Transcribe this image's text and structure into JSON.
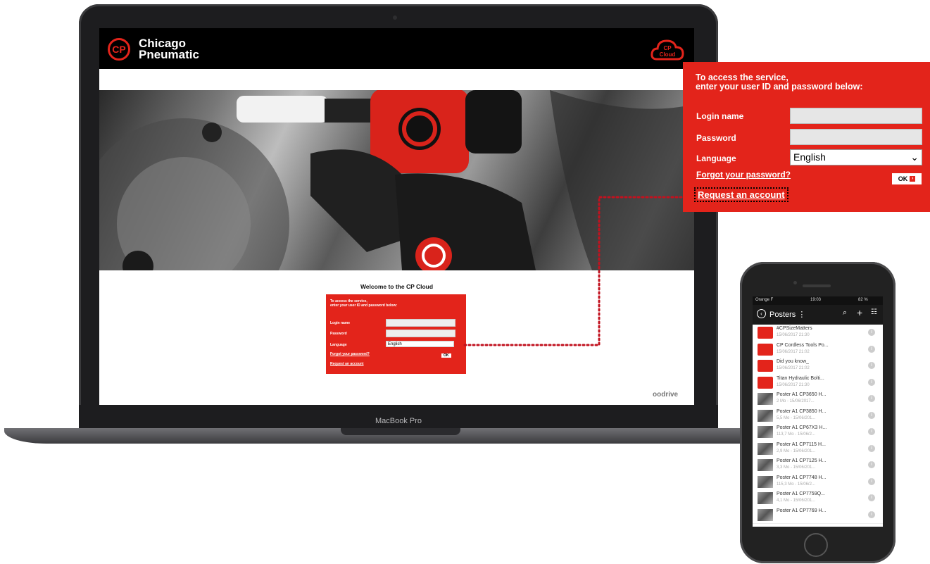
{
  "laptop": {
    "brand_line1": "Chicago",
    "brand_line2": "Pneumatic",
    "logo_letters": "CP",
    "cloud_logo_line1": "CP",
    "cloud_logo_line2": "Cloud",
    "model_label": "MacBook Pro",
    "welcome": "Welcome to the CP Cloud",
    "partner_logo": "oodrive",
    "login": {
      "title_line1": "To access the service,",
      "title_line2": "enter your user ID and password below:",
      "login_label": "Login name",
      "password_label": "Password",
      "language_label": "Language",
      "language_value": "English",
      "forgot_link": "Forgot your password?",
      "ok_label": "OK",
      "request_link": "Request an account"
    }
  },
  "callout": {
    "title_line1": "To access the service,",
    "title_line2": "enter your user ID and password below:",
    "login_label": "Login name",
    "password_label": "Password",
    "language_label": "Language",
    "language_value": "English",
    "forgot_link": "Forgot your password?",
    "ok_label": "OK",
    "request_link": "Request an account"
  },
  "phone": {
    "status": {
      "carrier": "Orange F",
      "time": "19:03",
      "battery": "82 %"
    },
    "nav_title": "Posters",
    "items": [
      {
        "kind": "folder",
        "name": "#CPSizeMatters",
        "meta": "15/06/2017 21:30"
      },
      {
        "kind": "folder",
        "name": "CP Cordless Tools Po...",
        "meta": "15/06/2017 21:02"
      },
      {
        "kind": "folder",
        "name": "Did you know_",
        "meta": "15/06/2017 21:02"
      },
      {
        "kind": "folder",
        "name": "Titan Hydraulic Bolti...",
        "meta": "15/06/2017 21:30"
      },
      {
        "kind": "file",
        "name": "Poster A1 CP3650 H...",
        "meta": "2 Mo - 15/06/2017..."
      },
      {
        "kind": "file",
        "name": "Poster A1 CP3850 H...",
        "meta": "5,5 Mo - 15/06/201..."
      },
      {
        "kind": "file",
        "name": "Poster A1 CP67X3 H...",
        "meta": "113,7 Mo - 15/06/2..."
      },
      {
        "kind": "file",
        "name": "Poster A1 CP7115 H...",
        "meta": "2,9 Mo - 15/06/201..."
      },
      {
        "kind": "file",
        "name": "Poster A1 CP7125 H...",
        "meta": "3,3 Mo - 15/06/201..."
      },
      {
        "kind": "file",
        "name": "Poster A1 CP7748 H...",
        "meta": "115,3 Mo - 15/06/2..."
      },
      {
        "kind": "file",
        "name": "Poster A1 CP7759Q...",
        "meta": "4,1 Mo - 15/06/201..."
      },
      {
        "kind": "file",
        "name": "Poster A1 CP7769 H...",
        "meta": ""
      }
    ]
  },
  "colors": {
    "brand_red": "#e3241b",
    "device_dark": "#1d1d1f"
  }
}
